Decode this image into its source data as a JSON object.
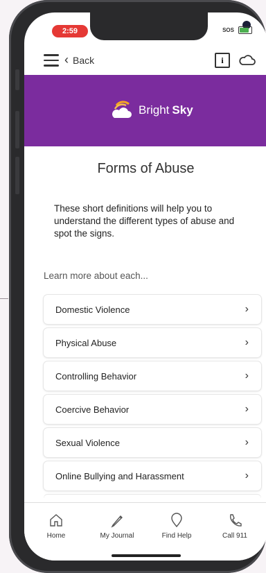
{
  "status_bar": {
    "time": "2:59",
    "sos": "SOS"
  },
  "toolbar": {
    "back_label": "Back",
    "info_glyph": "i"
  },
  "banner": {
    "brand_light": "Bright",
    "brand_bold": "Sky"
  },
  "page": {
    "title": "Forms of Abuse",
    "intro": "These short definitions will help you to understand the different types of abuse and spot the signs.",
    "learn_more": "Learn more about each..."
  },
  "items": [
    {
      "label": "Domestic Violence"
    },
    {
      "label": "Physical Abuse"
    },
    {
      "label": "Controlling Behavior"
    },
    {
      "label": "Coercive Behavior"
    },
    {
      "label": "Sexual Violence"
    },
    {
      "label": "Online Bullying and Harassment"
    }
  ],
  "tabs": [
    {
      "label": "Home",
      "icon": "home-icon"
    },
    {
      "label": "My Journal",
      "icon": "pencil-icon"
    },
    {
      "label": "Find Help",
      "icon": "location-pin-icon"
    },
    {
      "label": "Call 911",
      "icon": "phone-icon"
    }
  ],
  "colors": {
    "banner": "#7b2c9e",
    "time_pill": "#e53935",
    "battery": "#4caf50"
  }
}
